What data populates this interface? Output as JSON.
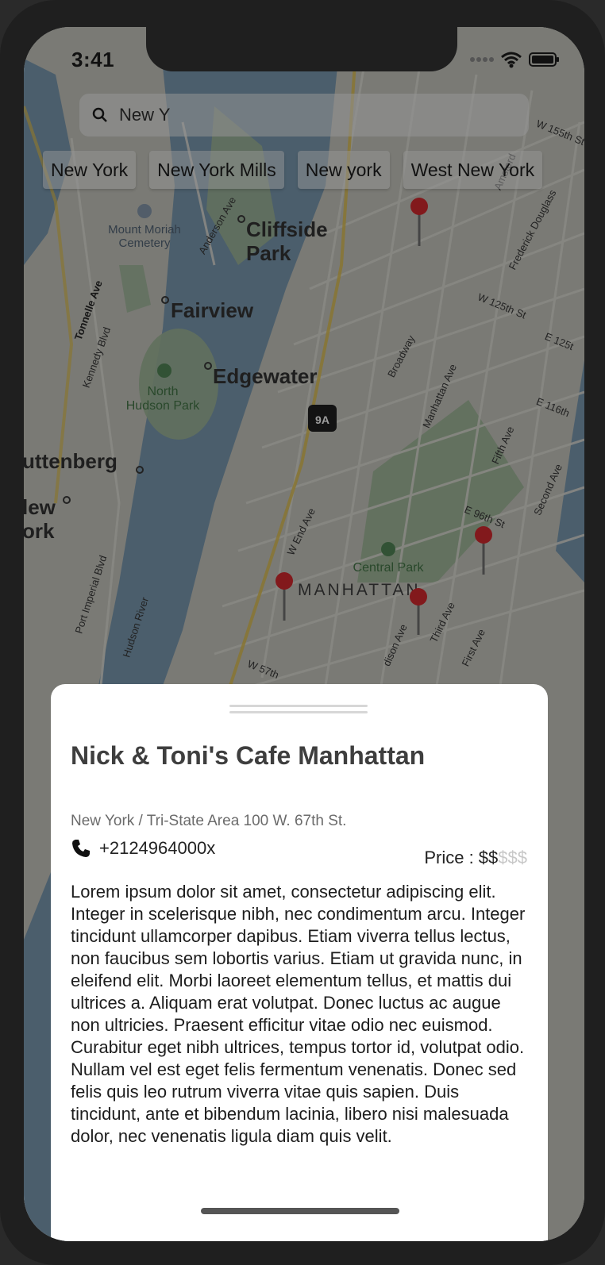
{
  "status": {
    "time": "3:41"
  },
  "search": {
    "value": "New Y"
  },
  "suggestions": [
    "New York",
    "New York Mills",
    "New york",
    "West New York"
  ],
  "map_labels": {
    "cliffside": "Cliffside\nPark",
    "fairview": "Fairview",
    "edgewater": "Edgewater",
    "guttenberg": "uttenberg",
    "new_york": "lew\nork",
    "north_hudson": "North\nHudson Park",
    "mount_moriah": "Mount Moriah\nCemetery",
    "central_park": "Central Park",
    "manhattan": "MANHATTAN",
    "route": "9A",
    "broadway": "Broadway",
    "manhattan_ave": "Manhattan Ave",
    "w_end_ave": "W End Ave",
    "fifth_ave": "Fifth Ave",
    "second_ave": "Second Ave",
    "e96": "E 96th St",
    "w125": "W 125th St",
    "e116": "E 116th",
    "w155": "W 155th St",
    "frederick": "Frederick Douglass",
    "kennedy": "Kennedy Blvd",
    "tonnelle": "Tonnelle Ave",
    "anderson": "Anderson Ave",
    "port_imperial": "Port Imperial Blvd",
    "hudson_river": "Hudson River",
    "third_ave": "Third Ave",
    "first_ave": "First Ave",
    "madison": "dison Ave",
    "w57": "W 57th",
    "amsterdam": "Amsterd",
    "e125": "E 125t"
  },
  "detail": {
    "title": "Nick & Toni's Cafe Manhattan",
    "address": "New York / Tri-State Area 100 W. 67th St.",
    "phone": "+2124964000x",
    "price_label": "Price : ",
    "price_active": "$$",
    "price_inactive": "$$$",
    "description": "Lorem ipsum dolor sit amet, consectetur adipiscing elit. Integer in scelerisque nibh, nec condimentum arcu. Integer tincidunt ullamcorper dapibus. Etiam viverra tellus lectus, non faucibus sem lobortis varius. Etiam ut gravida nunc, in eleifend elit. Morbi laoreet elementum tellus, et mattis dui ultrices a. Aliquam erat volutpat. Donec luctus ac augue non ultricies. Praesent efficitur vitae odio nec euismod. Curabitur eget nibh ultrices, tempus tortor id, volutpat odio. Nullam vel est eget felis fermentum venenatis. Donec sed felis quis leo rutrum viverra vitae quis sapien. Duis tincidunt, ante et bibendum lacinia, libero nisi malesuada dolor, nec venenatis ligula diam quis velit."
  },
  "colors": {
    "pin": "#c0262a",
    "water": "#5f7e93",
    "park": "#7fa07a",
    "land": "#a8a8a2"
  }
}
